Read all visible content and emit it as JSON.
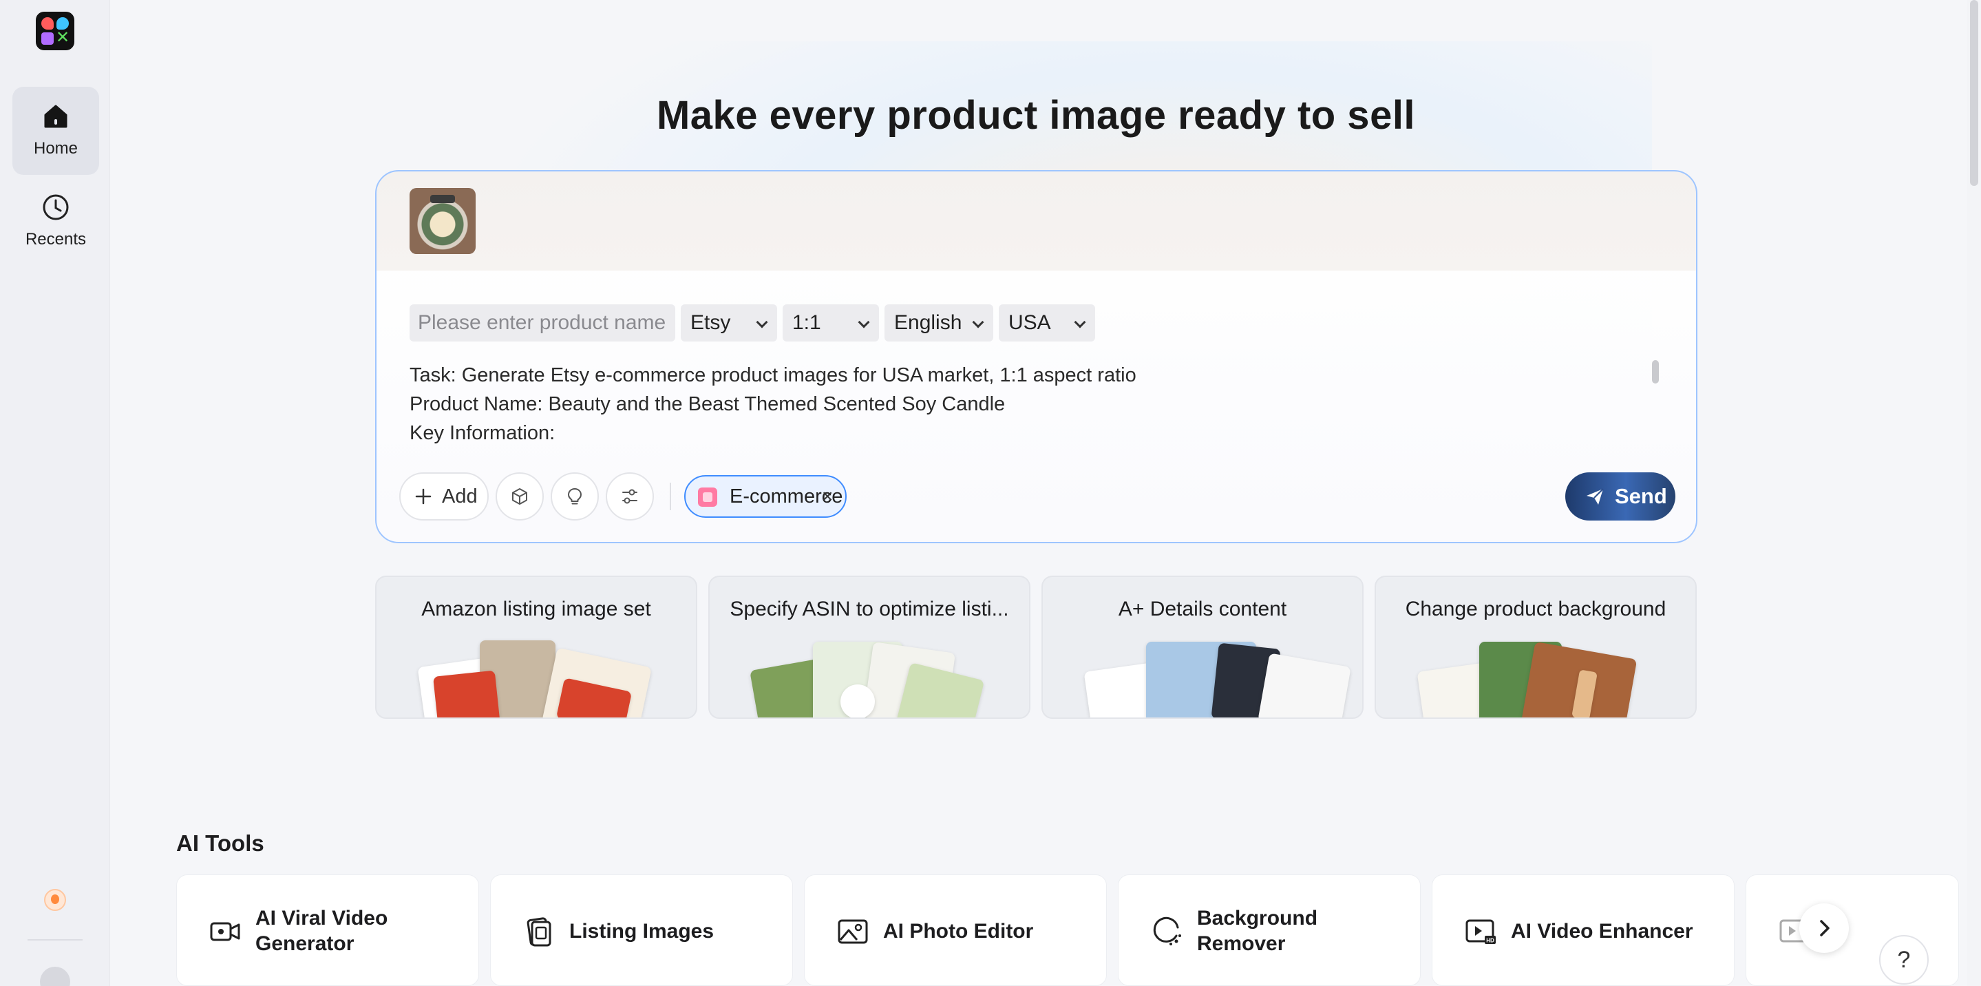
{
  "sidebar": {
    "items": [
      {
        "label": "Home",
        "icon": "home-icon",
        "active": true
      },
      {
        "label": "Recents",
        "icon": "clock-icon",
        "active": false
      }
    ]
  },
  "hero": {
    "title": "Make every product image ready to sell"
  },
  "composer": {
    "product_name_placeholder": "Please enter product name",
    "platform": "Etsy",
    "aspect_ratio": "1:1",
    "language": "English",
    "market": "USA",
    "prompt_lines": [
      "Task: Generate Etsy e-commerce product images for USA market, 1:1 aspect ratio",
      "Product Name: Beauty and the Beast Themed Scented Soy Candle",
      "Key Information:"
    ],
    "add_label": "Add",
    "chip_label": "E-commerce",
    "chip_close": "×",
    "send_label": "Send"
  },
  "suggestions": [
    {
      "title": "Amazon listing image set"
    },
    {
      "title": "Specify ASIN to optimize listi..."
    },
    {
      "title": "A+ Details content"
    },
    {
      "title": "Change product background"
    }
  ],
  "tools": {
    "heading": "AI Tools",
    "items": [
      {
        "label": "AI Viral Video Generator",
        "icon": "video-camera-icon"
      },
      {
        "label": "Listing Images",
        "icon": "listing-images-icon"
      },
      {
        "label": "AI Photo Editor",
        "icon": "photo-icon"
      },
      {
        "label": "Background Remover",
        "icon": "background-remover-icon"
      },
      {
        "label": "AI Video Enhancer",
        "icon": "hd-video-icon"
      }
    ]
  },
  "help_label": "?",
  "colors": {
    "accent_border": "#9ec5ff",
    "chip_border": "#3f8cff",
    "send_button": "#2c4f8c"
  }
}
